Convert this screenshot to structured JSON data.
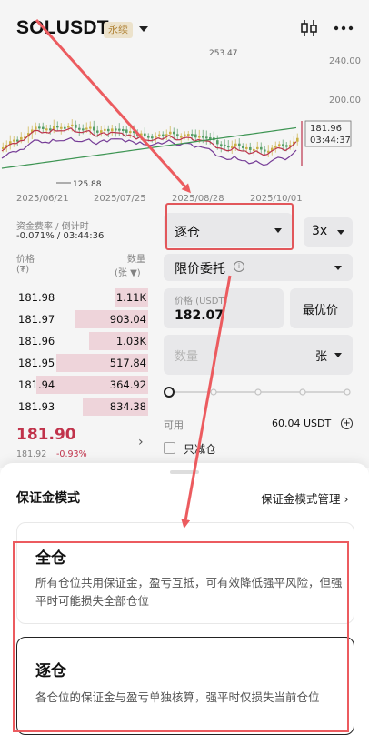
{
  "header": {
    "symbol": "SOLUSDT",
    "badge": "永续"
  },
  "chart": {
    "price_labels": [
      "240.00",
      "200.00",
      "181.96",
      "03:44:37"
    ],
    "date_labels": [
      "2025/06/21",
      "2025/07/25",
      "2025/08/28",
      "2025/10/01"
    ],
    "peak_label": "253.47",
    "low_label": "125.88",
    "colors": {
      "up": "#d4b94a",
      "down": "#5aa56b",
      "ma1": "#c4364f",
      "ma2": "#7a3e9d",
      "ma3": "#3f9b56"
    }
  },
  "funding": {
    "label": "资金费率 / 倒计时",
    "value": "-0.071% / 03:44:36"
  },
  "orderbook": {
    "price_header": "价格",
    "price_unit": "(₮)",
    "qty_header": "数量",
    "qty_unit": "(张 ▼)",
    "asks": [
      {
        "price": "181.98",
        "qty": "1.11K",
        "depth": 0.25
      },
      {
        "price": "181.97",
        "qty": "903.04",
        "depth": 0.55
      },
      {
        "price": "181.96",
        "qty": "1.03K",
        "depth": 0.45
      },
      {
        "price": "181.95",
        "qty": "517.84",
        "depth": 0.7
      },
      {
        "price": "181.94",
        "qty": "364.92",
        "depth": 0.85
      },
      {
        "price": "181.93",
        "qty": "834.38",
        "depth": 0.5
      }
    ],
    "last_price": "181.90",
    "mark_price": "181.92",
    "change": "-0.93%"
  },
  "order_form": {
    "margin_mode": "逐仓",
    "leverage": "3x",
    "order_type": "限价委托",
    "price_label": "价格 (USDT)",
    "price_value": "182.07",
    "best_price": "最优价",
    "qty_placeholder": "数量",
    "qty_unit": "张",
    "available_label": "可用",
    "available_value": "60.04 USDT",
    "reduce_only": "只减仓"
  },
  "sheet": {
    "title": "保证金模式",
    "manage_link": "保证金模式管理",
    "options": [
      {
        "title": "全仓",
        "desc": "所有仓位共用保证金，盈亏互抵，可有效降低强平风险，但强平时可能损失全部仓位"
      },
      {
        "title": "逐仓",
        "desc": "各仓位的保证金与盈亏单独核算，强平时仅损失当前仓位"
      }
    ]
  },
  "annotation_color": "#ec5b5f"
}
